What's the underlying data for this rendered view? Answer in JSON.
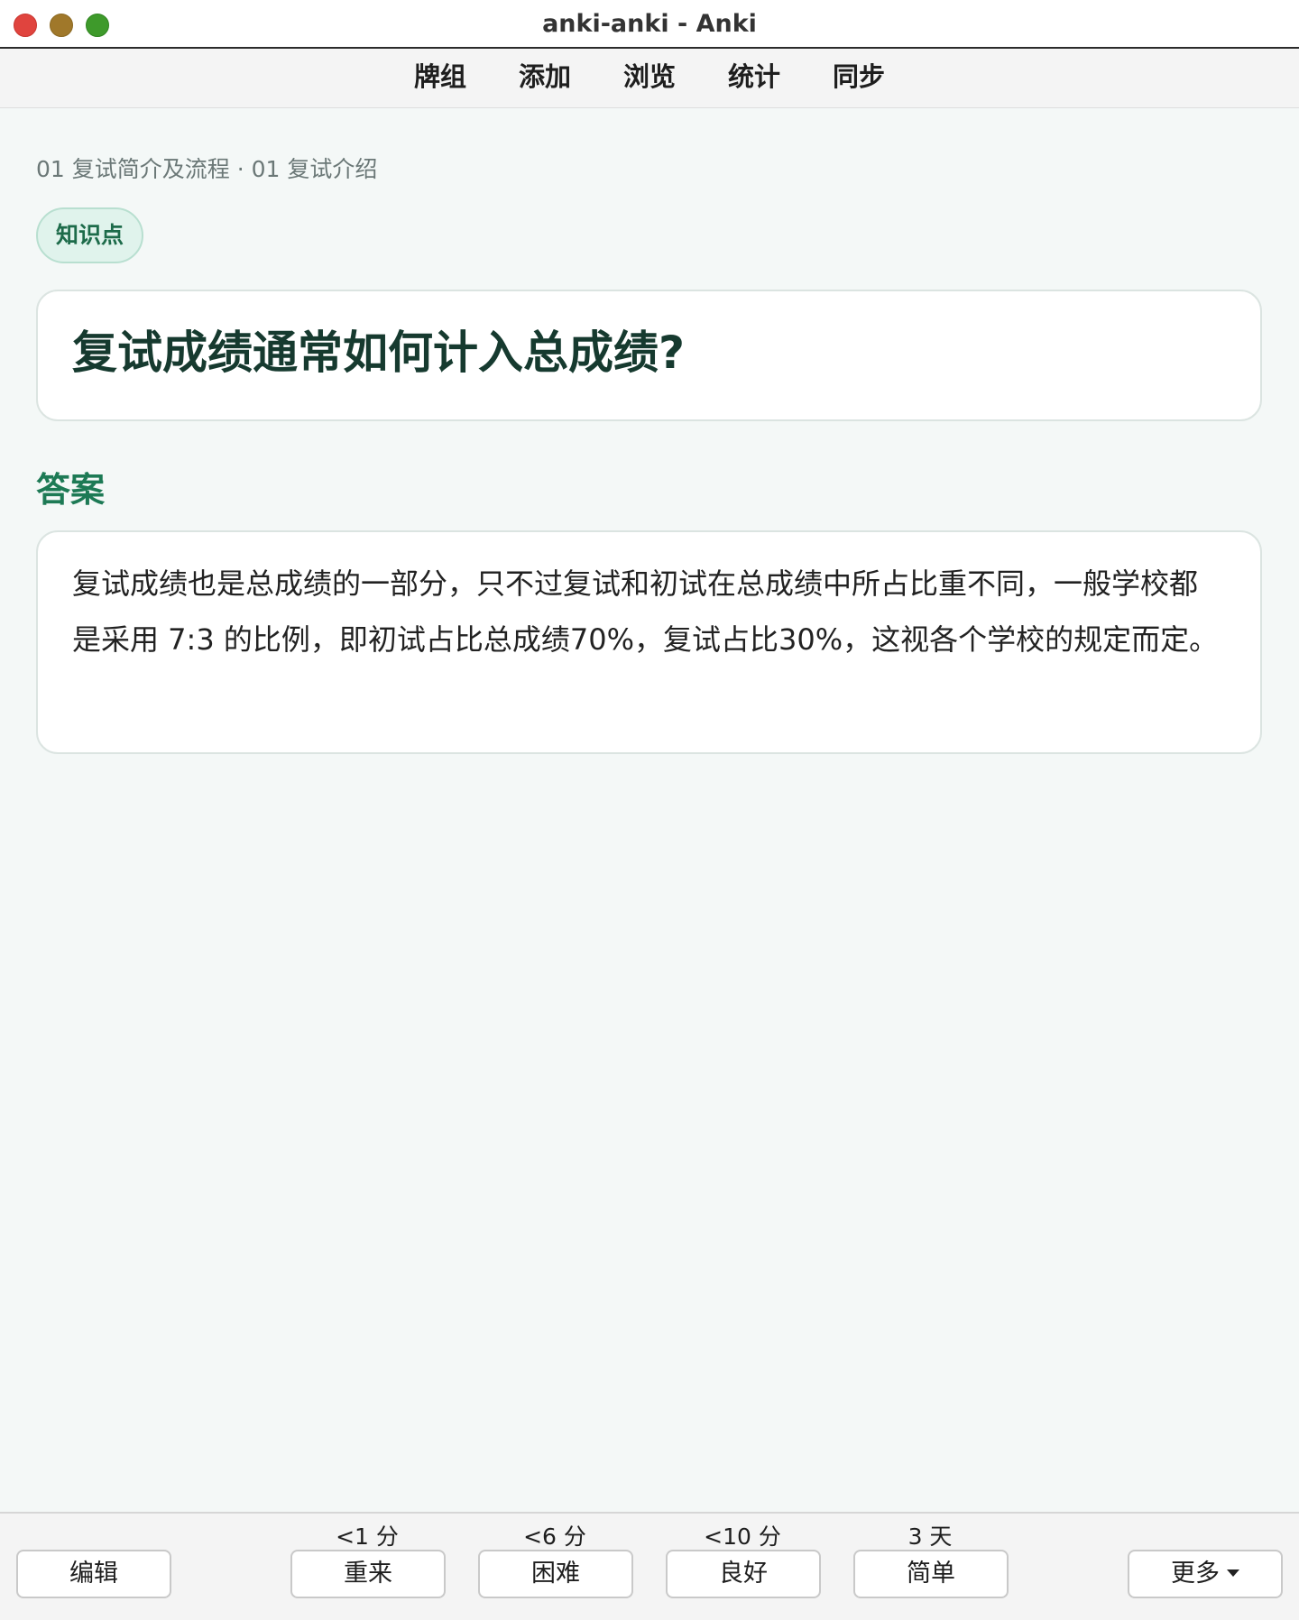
{
  "window": {
    "title": "anki-anki - Anki"
  },
  "toolbar": {
    "items": [
      {
        "label": "牌组"
      },
      {
        "label": "添加"
      },
      {
        "label": "浏览"
      },
      {
        "label": "统计"
      },
      {
        "label": "同步"
      }
    ]
  },
  "card": {
    "breadcrumb": "01 复试简介及流程 · 01 复试介绍",
    "tag": "知识点",
    "question": "复试成绩通常如何计入总成绩?",
    "answer_heading": "答案",
    "answer": "复试成绩也是总成绩的一部分，只不过复试和初试在总成绩中所占比重不同，一般学校都是采用 7:3 的比例，即初试占比总成绩70%，复试占比30%，这视各个学校的规定而定。"
  },
  "bottombar": {
    "edit_label": "编辑",
    "more_label": "更多",
    "answers": [
      {
        "interval": "<1 分",
        "label": "重来"
      },
      {
        "interval": "<6 分",
        "label": "困难"
      },
      {
        "interval": "<10 分",
        "label": "良好"
      },
      {
        "interval": "3 天",
        "label": "简单"
      }
    ]
  },
  "colors": {
    "accent": "#1d7a55",
    "tag_bg": "#e0f3ec",
    "content_bg": "#f4f8f7"
  }
}
